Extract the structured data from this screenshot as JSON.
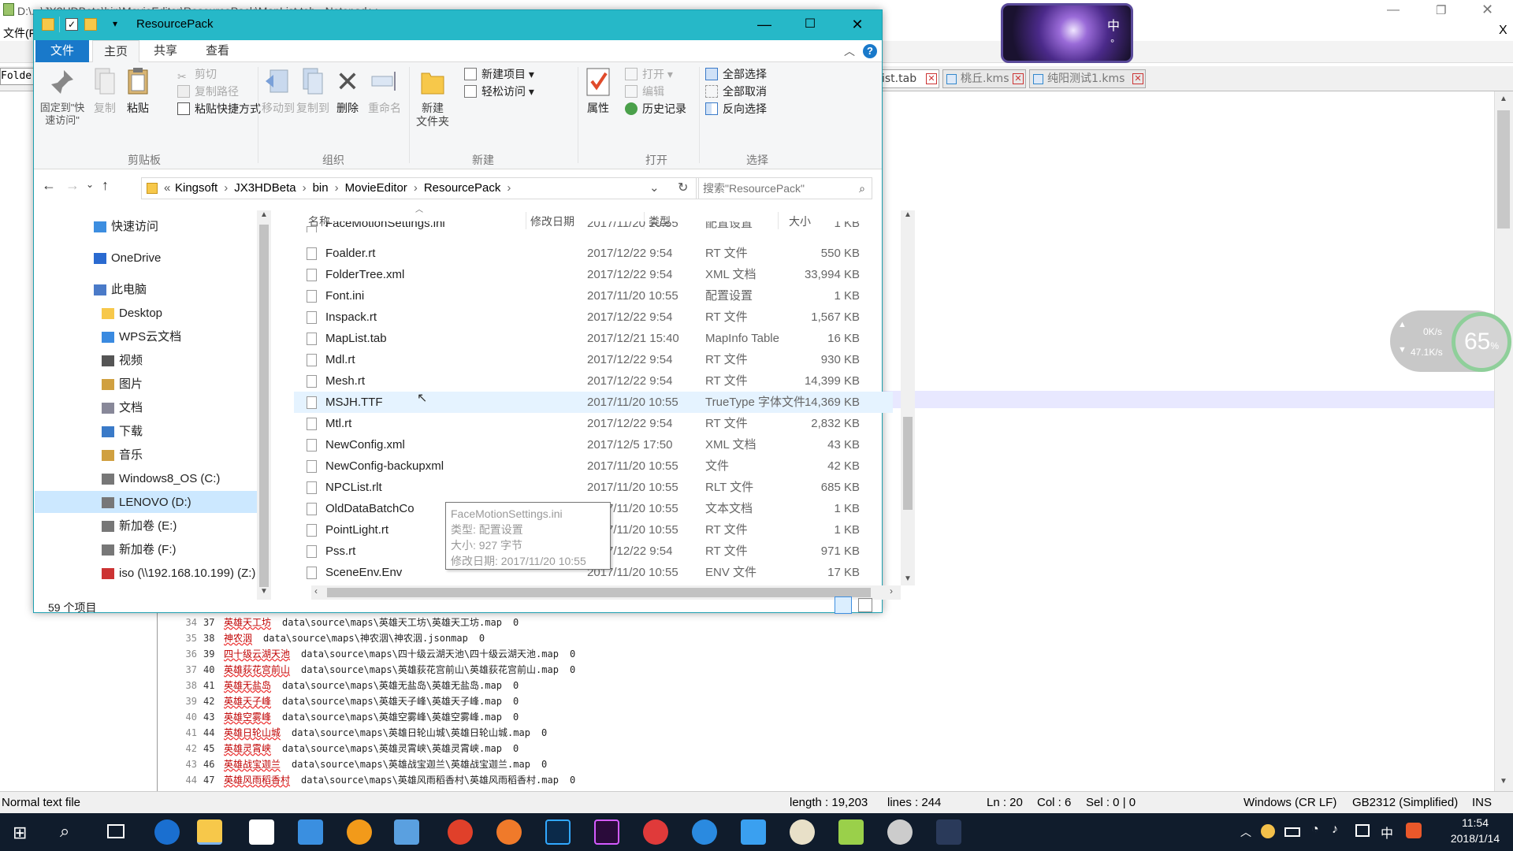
{
  "npp": {
    "title_fragment": "D:\\...\\JX3HDBeta\\bin\\MovieEditor\\ResourcePack\\MapList.tab - Notepad++",
    "menu_fragment": "文件(F)",
    "left_panel_label": "Folde",
    "tabs": [
      {
        "label": "ist.tab"
      },
      {
        "label": "桃丘.kms"
      },
      {
        "label": "纯阳测试1.kms"
      }
    ],
    "code_lines": [
      {
        "ln": "34",
        "n": "37",
        "name": "英雄天工坊",
        "path": "data\\source\\maps\\英雄天工坊\\英雄天工坊.map",
        "v": "0"
      },
      {
        "ln": "35",
        "n": "38",
        "name": "神农洇",
        "path": "data\\source\\maps\\神农洇\\神农洇.jsonmap",
        "v": "0"
      },
      {
        "ln": "36",
        "n": "39",
        "name": "四十级云湖天池",
        "path": "data\\source\\maps\\四十级云湖天池\\四十级云湖天池.map",
        "v": "0"
      },
      {
        "ln": "37",
        "n": "40",
        "name": "英雄荻花宫前山",
        "path": "data\\source\\maps\\英雄荻花宫前山\\英雄荻花宫前山.map",
        "v": "0"
      },
      {
        "ln": "38",
        "n": "41",
        "name": "英雄无盐岛",
        "path": "data\\source\\maps\\英雄无盐岛\\英雄无盐岛.map",
        "v": "0"
      },
      {
        "ln": "39",
        "n": "42",
        "name": "英雄天子峰",
        "path": "data\\source\\maps\\英雄天子峰\\英雄天子峰.map",
        "v": "0"
      },
      {
        "ln": "40",
        "n": "43",
        "name": "英雄空雾峰",
        "path": "data\\source\\maps\\英雄空雾峰\\英雄空雾峰.map",
        "v": "0"
      },
      {
        "ln": "41",
        "n": "44",
        "name": "英雄日轮山城",
        "path": "data\\source\\maps\\英雄日轮山城\\英雄日轮山城.map",
        "v": "0"
      },
      {
        "ln": "42",
        "n": "45",
        "name": "英雄灵霄峡",
        "path": "data\\source\\maps\\英雄灵霄峡\\英雄灵霄峡.map",
        "v": "0"
      },
      {
        "ln": "43",
        "n": "46",
        "name": "英雄战宝迦兰",
        "path": "data\\source\\maps\\英雄战宝迦兰\\英雄战宝迦兰.map",
        "v": "0"
      },
      {
        "ln": "44",
        "n": "47",
        "name": "英雄风雨稻香村",
        "path": "data\\source\\maps\\英雄风雨稻香村\\英雄风雨稻香村.map",
        "v": "0"
      }
    ],
    "status": {
      "mode": "Normal text file",
      "length": "length : 19,203",
      "lines": "lines : 244",
      "ln": "Ln : 20",
      "col": "Col : 6",
      "sel": "Sel : 0 | 0",
      "eol": "Windows (CR LF)",
      "encoding": "GB2312 (Simplified)",
      "ins": "INS"
    }
  },
  "explorer": {
    "title": "ResourcePack",
    "ribbon_tabs": [
      "文件",
      "主页",
      "共享",
      "查看"
    ],
    "ribbon": {
      "pin": "固定到\"快速访问\"",
      "copy": "复制",
      "paste": "粘贴",
      "cut": "剪切",
      "copy_path": "复制路径",
      "paste_shortcut": "粘贴快捷方式",
      "clipboard": "剪贴板",
      "move_to": "移动到",
      "copy_to": "复制到",
      "delete": "删除",
      "rename": "重命名",
      "organize": "组织",
      "new_folder": "新建\n文件夹",
      "new_item": "新建项目",
      "easy_access": "轻松访问",
      "new_group": "新建",
      "properties": "属性",
      "open": "打开",
      "edit": "编辑",
      "history": "历史记录",
      "open_group": "打开",
      "select_all": "全部选择",
      "select_none": "全部取消",
      "invert": "反向选择",
      "select_group": "选择"
    },
    "breadcrumb": [
      "Kingsoft",
      "JX3HDBeta",
      "bin",
      "MovieEditor",
      "ResourcePack"
    ],
    "search_placeholder": "搜索\"ResourcePack\"",
    "nav": [
      {
        "label": "快速访问",
        "icon": "star-icon"
      },
      {
        "label": "OneDrive",
        "icon": "cloud-icon"
      },
      {
        "label": "此电脑",
        "icon": "computer-icon"
      },
      {
        "label": "Desktop",
        "icon": "folder-icon"
      },
      {
        "label": "WPS云文档",
        "icon": "cloud-icon"
      },
      {
        "label": "视频",
        "icon": "video-icon"
      },
      {
        "label": "图片",
        "icon": "picture-icon"
      },
      {
        "label": "文档",
        "icon": "document-icon"
      },
      {
        "label": "下载",
        "icon": "download-icon"
      },
      {
        "label": "音乐",
        "icon": "music-icon"
      },
      {
        "label": "Windows8_OS (C:)",
        "icon": "drive-icon"
      },
      {
        "label": "LENOVO (D:)",
        "icon": "drive-icon"
      },
      {
        "label": "新加卷 (E:)",
        "icon": "drive-icon"
      },
      {
        "label": "新加卷 (F:)",
        "icon": "drive-icon"
      },
      {
        "label": "iso (\\\\192.168.10.199) (Z:)",
        "icon": "network-drive-icon"
      }
    ],
    "columns": {
      "name": "名称",
      "date": "修改日期",
      "type": "类型",
      "size": "大小"
    },
    "files": [
      {
        "name": "FaceMotionSettings.ini",
        "date": "2017/11/20 10:55",
        "type": "配置设置",
        "size": "1 KB"
      },
      {
        "name": "Foalder.rt",
        "date": "2017/12/22 9:54",
        "type": "RT 文件",
        "size": "550 KB"
      },
      {
        "name": "FolderTree.xml",
        "date": "2017/12/22 9:54",
        "type": "XML 文档",
        "size": "33,994 KB"
      },
      {
        "name": "Font.ini",
        "date": "2017/11/20 10:55",
        "type": "配置设置",
        "size": "1 KB"
      },
      {
        "name": "Inspack.rt",
        "date": "2017/12/22 9:54",
        "type": "RT 文件",
        "size": "1,567 KB"
      },
      {
        "name": "MapList.tab",
        "date": "2017/12/21 15:40",
        "type": "MapInfo Table",
        "size": "16 KB"
      },
      {
        "name": "Mdl.rt",
        "date": "2017/12/22 9:54",
        "type": "RT 文件",
        "size": "930 KB"
      },
      {
        "name": "Mesh.rt",
        "date": "2017/12/22 9:54",
        "type": "RT 文件",
        "size": "14,399 KB"
      },
      {
        "name": "MSJH.TTF",
        "date": "2017/11/20 10:55",
        "type": "TrueType 字体文件",
        "size": "14,369 KB"
      },
      {
        "name": "Mtl.rt",
        "date": "2017/12/22 9:54",
        "type": "RT 文件",
        "size": "2,832 KB"
      },
      {
        "name": "NewConfig.xml",
        "date": "2017/12/5 17:50",
        "type": "XML 文档",
        "size": "43 KB"
      },
      {
        "name": "NewConfig-backupxml",
        "date": "2017/11/20 10:55",
        "type": "文件",
        "size": "42 KB"
      },
      {
        "name": "NPCList.rlt",
        "date": "2017/11/20 10:55",
        "type": "RLT 文件",
        "size": "685 KB"
      },
      {
        "name": "OldDataBatchCo",
        "date": "2017/11/20 10:55",
        "type": "文本文档",
        "size": "1 KB"
      },
      {
        "name": "PointLight.rt",
        "date": "2017/11/20 10:55",
        "type": "RT 文件",
        "size": "1 KB"
      },
      {
        "name": "Pss.rt",
        "date": "2017/12/22 9:54",
        "type": "RT 文件",
        "size": "971 KB"
      },
      {
        "name": "SceneEnv.Env",
        "date": "2017/11/20 10:55",
        "type": "ENV 文件",
        "size": "17 KB"
      }
    ],
    "tooltip": {
      "name": "FaceMotionSettings.ini",
      "type": "类型: 配置设置",
      "size": "大小: 927 字节",
      "date": "修改日期: 2017/11/20 10:55"
    },
    "item_count": "59 个项目"
  },
  "ime": {
    "char1": "中",
    "char2": "°"
  },
  "net": {
    "up": "0K/s",
    "down": "47.1K/s",
    "percent": "65",
    "percent_sign": "%"
  },
  "tray": {
    "ime": "中",
    "time": "11:54",
    "date": "2018/1/14"
  },
  "colors": {
    "explorer_title": "#26b8c8",
    "file_tab": "#1979ca",
    "taskbar": "#101c2c"
  }
}
